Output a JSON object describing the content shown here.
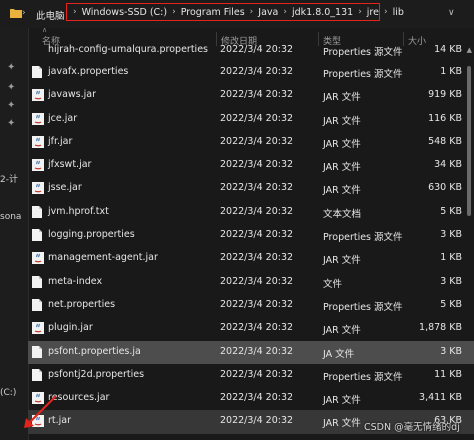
{
  "address_bar": {
    "root_label": "此电脑",
    "crumbs": [
      "Windows-SSD (C:)",
      "Program Files",
      "Java",
      "jdk1.8.0_131",
      "jre",
      "lib"
    ]
  },
  "columns": {
    "name": "名称",
    "date": "修改日期",
    "type": "类型",
    "size": "大小"
  },
  "sidebar_text": {
    "a": "2-计",
    "b": "sona",
    "c": "(C:)"
  },
  "files": [
    {
      "icon": "file",
      "name": "hijrah-config-umalqura.properties",
      "date": "2022/3/4 20:32",
      "type": "Properties 源文件",
      "size": "14 KB"
    },
    {
      "icon": "file",
      "name": "javafx.properties",
      "date": "2022/3/4 20:32",
      "type": "Properties 源文件",
      "size": "1 KB"
    },
    {
      "icon": "jar",
      "name": "javaws.jar",
      "date": "2022/3/4 20:32",
      "type": "JAR 文件",
      "size": "919 KB"
    },
    {
      "icon": "jar",
      "name": "jce.jar",
      "date": "2022/3/4 20:32",
      "type": "JAR 文件",
      "size": "116 KB"
    },
    {
      "icon": "jar",
      "name": "jfr.jar",
      "date": "2022/3/4 20:32",
      "type": "JAR 文件",
      "size": "548 KB"
    },
    {
      "icon": "jar",
      "name": "jfxswt.jar",
      "date": "2022/3/4 20:32",
      "type": "JAR 文件",
      "size": "34 KB"
    },
    {
      "icon": "jar",
      "name": "jsse.jar",
      "date": "2022/3/4 20:32",
      "type": "JAR 文件",
      "size": "630 KB"
    },
    {
      "icon": "file",
      "name": "jvm.hprof.txt",
      "date": "2022/3/4 20:32",
      "type": "文本文档",
      "size": "5 KB"
    },
    {
      "icon": "file",
      "name": "logging.properties",
      "date": "2022/3/4 20:32",
      "type": "Properties 源文件",
      "size": "3 KB"
    },
    {
      "icon": "jar",
      "name": "management-agent.jar",
      "date": "2022/3/4 20:32",
      "type": "JAR 文件",
      "size": "1 KB"
    },
    {
      "icon": "file",
      "name": "meta-index",
      "date": "2022/3/4 20:32",
      "type": "文件",
      "size": "3 KB"
    },
    {
      "icon": "file",
      "name": "net.properties",
      "date": "2022/3/4 20:32",
      "type": "Properties 源文件",
      "size": "5 KB"
    },
    {
      "icon": "jar",
      "name": "plugin.jar",
      "date": "2022/3/4 20:32",
      "type": "JAR 文件",
      "size": "1,878 KB"
    },
    {
      "icon": "file",
      "name": "psfont.properties.ja",
      "date": "2022/3/4 20:32",
      "type": "JA 文件",
      "size": "3 KB"
    },
    {
      "icon": "file",
      "name": "psfontj2d.properties",
      "date": "2022/3/4 20:32",
      "type": "Properties 源文件",
      "size": "11 KB"
    },
    {
      "icon": "jar",
      "name": "resources.jar",
      "date": "2022/3/4 20:32",
      "type": "JAR 文件",
      "size": "3,411 KB"
    },
    {
      "icon": "jar",
      "name": "rt.jar",
      "date": "2022/3/4 20:32",
      "type": "JAR 文件",
      "size": "63 KB"
    }
  ],
  "watermark": "CSDN @毫无情绪的dj",
  "colors": {
    "highlight_border": "#e3241b",
    "selected_row": "#4d4d4d",
    "background": "#191919",
    "arrow": "#e3241b"
  }
}
